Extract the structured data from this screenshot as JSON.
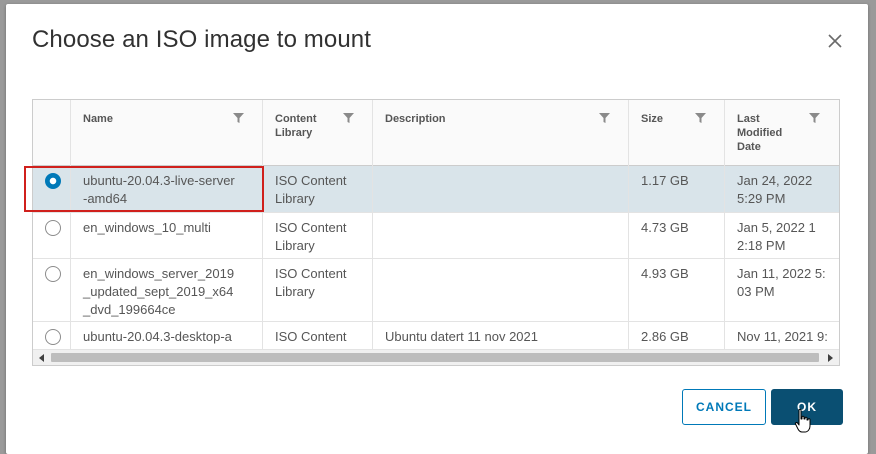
{
  "dialog": {
    "title": "Choose an ISO image to mount"
  },
  "grid": {
    "columns": [
      {
        "key": "name",
        "label": "Name"
      },
      {
        "key": "library",
        "label": "Content Library"
      },
      {
        "key": "description",
        "label": "Description"
      },
      {
        "key": "size",
        "label": "Size"
      },
      {
        "key": "modified",
        "label": "Last Modified Date"
      }
    ],
    "rows": [
      {
        "name": "ubuntu-20.04.3-live-server-amd64",
        "library": "ISO Content Library",
        "description": "",
        "size": "1.17 GB",
        "modified": "Jan 24, 2022 5:29 PM",
        "selected": true
      },
      {
        "name": "en_windows_10_multi",
        "library": "ISO Content Library",
        "description": "",
        "size": "4.73 GB",
        "modified": "Jan 5, 2022 12:18 PM",
        "selected": false
      },
      {
        "name": "en_windows_server_2019_updated_sept_2019_x64_dvd_199664ce",
        "library": "ISO Content Library",
        "description": "",
        "size": "4.93 GB",
        "modified": "Jan 11, 2022 5:03 PM",
        "selected": false
      },
      {
        "name": "ubuntu-20.04.3-desktop-a",
        "library": "ISO Content",
        "description": "Ubuntu datert 11 nov 2021",
        "size": "2.86 GB",
        "modified": "Nov 11, 2021 9:",
        "selected": false
      }
    ],
    "display": {
      "rows": [
        {
          "name": [
            "ubuntu-20.04.3-live-server",
            "-amd64"
          ],
          "library": [
            "ISO Content",
            "Library"
          ],
          "size": "1.17 GB",
          "modified": [
            "Jan 24, 2022",
            "5:29 PM"
          ]
        },
        {
          "name": [
            "en_windows_10_multi"
          ],
          "library": [
            "ISO Content",
            "Library"
          ],
          "size": "4.73 GB",
          "modified": [
            "Jan 5, 2022 1",
            "2:18 PM"
          ]
        },
        {
          "name": [
            "en_windows_server_2019",
            "_updated_sept_2019_x64",
            "_dvd_199664ce"
          ],
          "library": [
            "ISO Content",
            "Library"
          ],
          "size": "4.93 GB",
          "modified": [
            "Jan 11, 2022 5:",
            "03 PM"
          ]
        },
        {
          "name": [
            "ubuntu-20.04.3-desktop-a"
          ],
          "library": [
            "ISO Content"
          ],
          "description": "Ubuntu datert 11 nov 2021",
          "size": "2.86 GB",
          "modified": [
            "Nov 11, 2021 9:"
          ]
        }
      ],
      "headers": {
        "name": [
          "Name"
        ],
        "library": [
          "Content",
          "Library"
        ],
        "description": [
          "Description"
        ],
        "size": [
          "Size"
        ],
        "modified": [
          "Last",
          "Modified",
          "Date"
        ]
      }
    }
  },
  "buttons": {
    "cancel": "CANCEL",
    "ok": "OK"
  },
  "colors": {
    "primary": "#0079b8",
    "ok_bg": "#0a4f72",
    "selected_row": "#d9e4ea",
    "highlight_box": "#d0201c"
  },
  "icons": [
    "close-icon",
    "filter-icon",
    "scroll-left-icon",
    "scroll-right-icon",
    "hand-cursor-icon"
  ]
}
